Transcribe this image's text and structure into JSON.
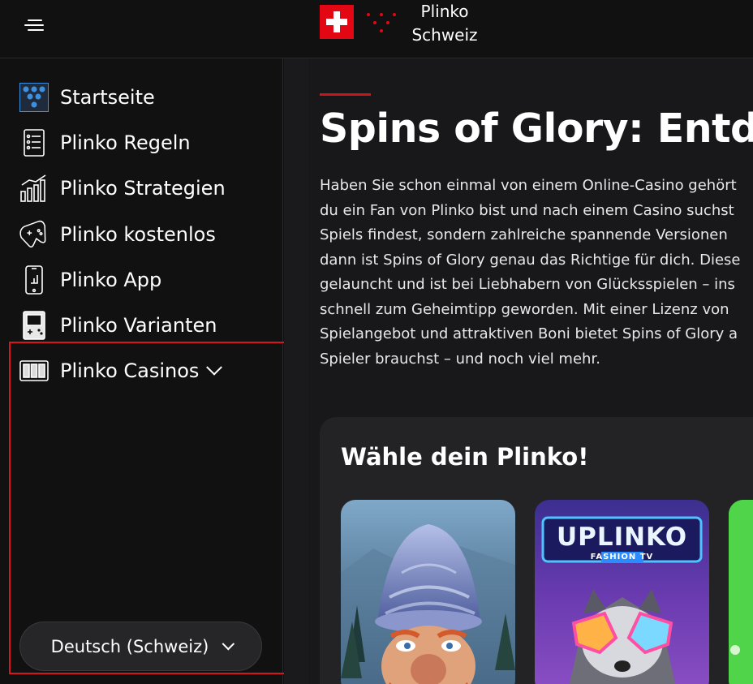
{
  "header": {
    "brand_line1": "Plinko",
    "brand_line2": "Schweiz"
  },
  "sidebar": {
    "items": [
      {
        "label": "Startseite",
        "icon": "plinko-dots-icon"
      },
      {
        "label": "Plinko Regeln",
        "icon": "rules-list-icon"
      },
      {
        "label": "Plinko Strategien",
        "icon": "bar-chart-icon"
      },
      {
        "label": "Plinko kostenlos",
        "icon": "gamepad-icon"
      },
      {
        "label": "Plinko App",
        "icon": "smartphone-icon"
      },
      {
        "label": "Plinko Varianten",
        "icon": "handheld-console-icon"
      },
      {
        "label": "Plinko Casinos",
        "icon": "slot-machine-icon"
      }
    ],
    "language": "Deutsch (Schweiz)"
  },
  "main": {
    "title": "Spins of Glory: Entdec",
    "paragraph_lines": [
      "Haben Sie schon einmal von einem Online-Casino gehört",
      "du ein Fan von Plinko bist und nach einem Casino suchst",
      "Spiels findest, sondern zahlreiche spannende Versionen",
      "dann ist Spins of Glory genau das Richtige für dich. Diese",
      "gelauncht und ist bei Liebhabern von Glücksspielen – ins",
      "schnell zum Geheimtipp geworden. Mit einer Lizenz von",
      "Spielangebot und attraktiven Boni bietet Spins of Glory a",
      "Spieler brauchst – und noch viel mehr."
    ],
    "panel_title": "Wähle dein Plinko!",
    "cards": [
      {
        "name": "gnome-plinko"
      },
      {
        "name": "uplinko",
        "title": "UPLINKO",
        "subtitle": "FASHION TV"
      },
      {
        "name": "green-plinko"
      }
    ]
  },
  "colors": {
    "accent": "#c8161d",
    "flag_red": "#e30613",
    "icon_blue": "#3d8fe0",
    "highlight_border": "#d9141a"
  }
}
